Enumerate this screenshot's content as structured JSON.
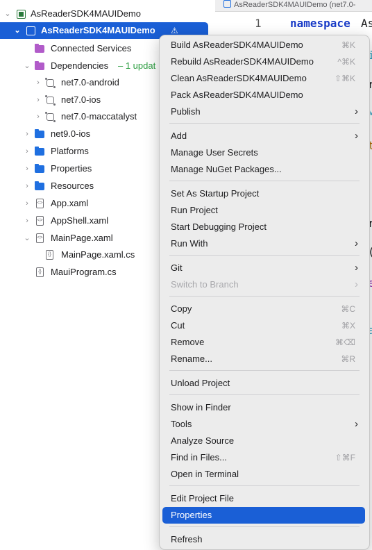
{
  "tree": {
    "root": {
      "label": "AsReaderSDK4MAUIDemo"
    },
    "project": {
      "label": "AsReaderSDK4MAUIDemo",
      "badge": "⚠"
    },
    "items": [
      {
        "label": "Connected Services"
      },
      {
        "label": "Dependencies",
        "note": "– 1 updat"
      },
      {
        "label": "net7.0-android"
      },
      {
        "label": "net7.0-ios"
      },
      {
        "label": "net7.0-maccatalyst"
      },
      {
        "label": "net9.0-ios"
      },
      {
        "label": "Platforms"
      },
      {
        "label": "Properties"
      },
      {
        "label": "Resources"
      },
      {
        "label": "App.xaml"
      },
      {
        "label": "AppShell.xaml"
      },
      {
        "label": "MainPage.xaml"
      },
      {
        "label": "MainPage.xaml.cs"
      },
      {
        "label": "MauiProgram.cs"
      }
    ]
  },
  "editor": {
    "tab_title": "AsReaderSDK4MAUIDemo (net7.0-",
    "line_number": "1",
    "keyword": "namespace",
    "identifier": "As"
  },
  "menu": {
    "items": [
      {
        "label": "Build AsReaderSDK4MAUIDemo",
        "shortcut": "⌘K"
      },
      {
        "label": "Rebuild AsReaderSDK4MAUIDemo",
        "shortcut": "^⌘K"
      },
      {
        "label": "Clean AsReaderSDK4MAUIDemo",
        "shortcut": "⇧⌘K"
      },
      {
        "label": "Pack AsReaderSDK4MAUIDemo"
      },
      {
        "label": "Publish",
        "submenu": true
      },
      {
        "label": "Add",
        "submenu": true
      },
      {
        "label": "Manage User Secrets"
      },
      {
        "label": "Manage NuGet Packages..."
      },
      {
        "label": "Set As Startup Project"
      },
      {
        "label": "Run Project"
      },
      {
        "label": "Start Debugging Project"
      },
      {
        "label": "Run With",
        "submenu": true
      },
      {
        "label": "Git",
        "submenu": true
      },
      {
        "label": "Switch to Branch",
        "submenu": true,
        "disabled": true
      },
      {
        "label": "Copy",
        "shortcut": "⌘C"
      },
      {
        "label": "Cut",
        "shortcut": "⌘X"
      },
      {
        "label": "Remove",
        "shortcut": "⌘⌫"
      },
      {
        "label": "Rename...",
        "shortcut": "⌘R"
      },
      {
        "label": "Unload Project"
      },
      {
        "label": "Show in Finder"
      },
      {
        "label": "Tools",
        "submenu": true
      },
      {
        "label": "Analyze Source"
      },
      {
        "label": "Find in Files...",
        "shortcut": "⇧⌘F"
      },
      {
        "label": "Open in Terminal"
      },
      {
        "label": "Edit Project File"
      },
      {
        "label": "Properties",
        "highlighted": true
      },
      {
        "label": "Refresh"
      }
    ],
    "submenu_arrow": "›"
  },
  "colors": {
    "selection": "#1a5fd6",
    "note": "#2a9d3f",
    "keyword": "#1a3cc8"
  }
}
